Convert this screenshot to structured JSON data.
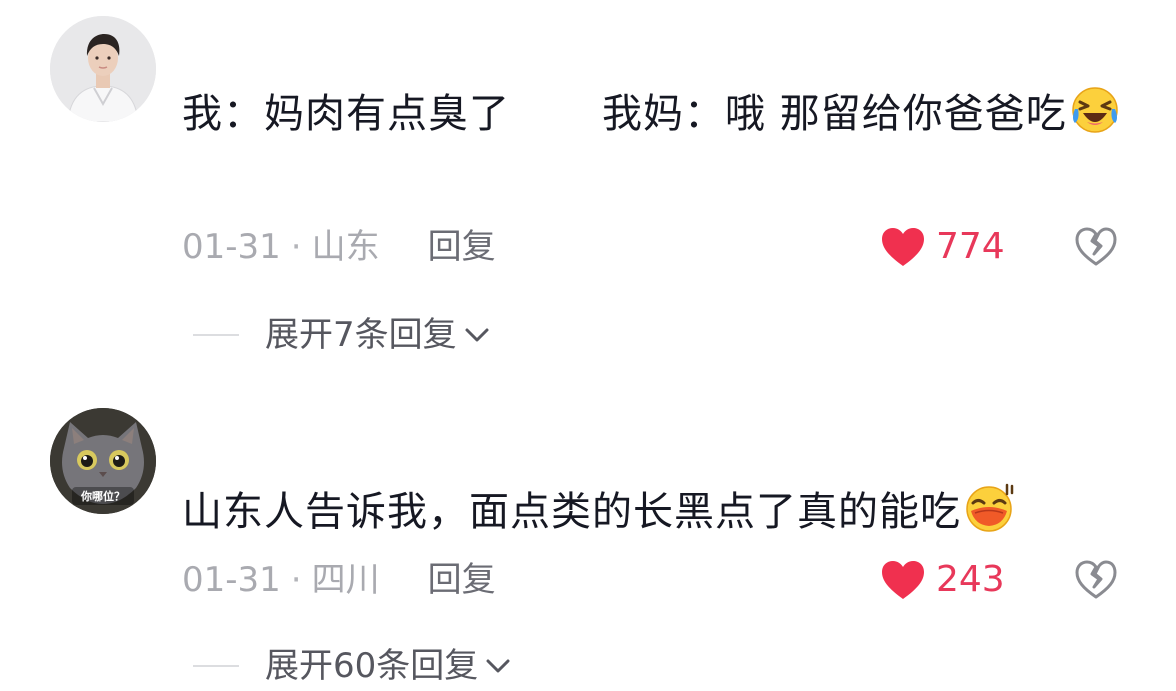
{
  "comments": [
    {
      "text_part1": "我：妈肉有点臭了",
      "text_part2": "我妈：哦 那留给你爸爸吃",
      "emoji": "laughing-crying-emoji",
      "date": "01-31",
      "separator": "·",
      "location": "山东",
      "reply_label": "回复",
      "like_count": "774",
      "expand_label": "展开7条回复"
    },
    {
      "text": "山东人告诉我，面点类的长黑点了真的能吃",
      "emoji": "sweat-smile-emoji",
      "avatar_caption": "你哪位？",
      "date": "01-31",
      "separator": "·",
      "location": "四川",
      "reply_label": "回复",
      "like_count": "243",
      "expand_label": "展开60条回复"
    }
  ],
  "colors": {
    "text_primary": "#161823",
    "text_meta": "#a9aab0",
    "text_secondary": "#56575f",
    "like_red": "#f0304f",
    "dislike_gray": "#8a8b91",
    "background": "#ffffff"
  }
}
